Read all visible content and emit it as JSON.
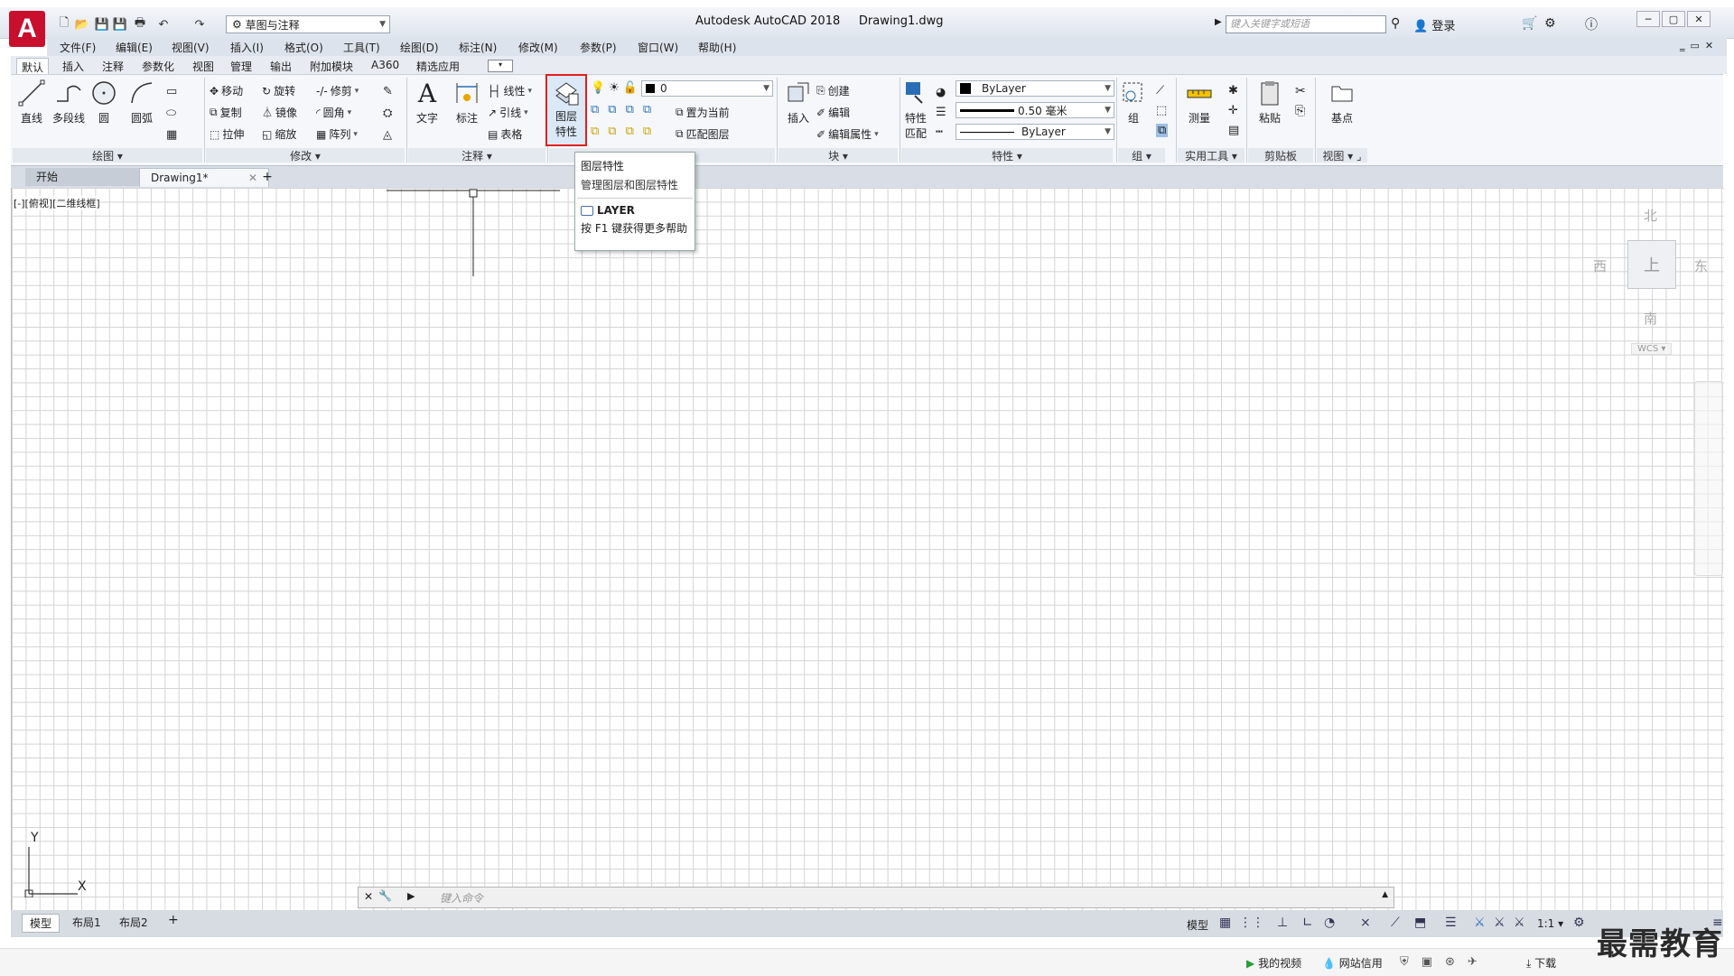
{
  "app": {
    "logo": "A",
    "title": "Autodesk AutoCAD 2018",
    "filename": "Drawing1.dwg",
    "workspace": "草图与注释",
    "search_placeholder": "键入关键字或短语",
    "login": "登录"
  },
  "menu": [
    "文件(F)",
    "编辑(E)",
    "视图(V)",
    "插入(I)",
    "格式(O)",
    "工具(T)",
    "绘图(D)",
    "标注(N)",
    "修改(M)",
    "参数(P)",
    "窗口(W)",
    "帮助(H)"
  ],
  "ribbon_tabs": [
    "默认",
    "插入",
    "注释",
    "参数化",
    "视图",
    "管理",
    "输出",
    "附加模块",
    "A360",
    "精选应用"
  ],
  "draw_panel": {
    "label": "绘图",
    "tools": [
      "直线",
      "多段线",
      "圆",
      "圆弧"
    ]
  },
  "modify_panel": {
    "label": "修改",
    "tools": [
      "移动",
      "旋转",
      "修剪",
      "复制",
      "镜像",
      "圆角",
      "拉伸",
      "缩放",
      "阵列"
    ]
  },
  "annotation_panel": {
    "label": "注释",
    "big": [
      "文字",
      "标注"
    ],
    "small": [
      "线性",
      "引线",
      "表格"
    ]
  },
  "layer_panel": {
    "big_line1": "图层",
    "big_line2": "特性",
    "layer_name": "0",
    "set_current": "置为当前",
    "match_layer": "匹配图层"
  },
  "block_panel": {
    "label": "块",
    "insert": "插入",
    "create": "创建",
    "edit": "编辑",
    "edit_attr": "编辑属性"
  },
  "properties_panel": {
    "label": "特性",
    "match_line1": "特性",
    "match_line2": "匹配",
    "color": "ByLayer",
    "lineweight": "0.50 毫米",
    "linetype": "ByLayer"
  },
  "group_panel": {
    "label": "组",
    "group": "组"
  },
  "utilities_panel": {
    "label": "实用工具",
    "measure": "测量"
  },
  "clipboard_panel": {
    "label": "剪贴板",
    "paste": "粘贴"
  },
  "view_panel": {
    "label": "视图",
    "base": "基点"
  },
  "doc_tabs": [
    "开始",
    "Drawing1*"
  ],
  "viewport_label": "[-][俯视][二维线框]",
  "tooltip": {
    "title": "图层特性",
    "desc": "管理图层和图层特性",
    "command": "LAYER",
    "help": "按 F1 键获得更多帮助"
  },
  "viewcube": {
    "north": "北",
    "south": "南",
    "east": "东",
    "west": "西",
    "face": "上",
    "wcs": "WCS"
  },
  "ucs": {
    "x": "X",
    "y": "Y"
  },
  "command": {
    "placeholder": "键入命令"
  },
  "layout_tabs": [
    "模型",
    "布局1",
    "布局2"
  ],
  "status": {
    "mode": "模型",
    "scale": "1:1"
  },
  "taskbar": {
    "video": "我的视频",
    "credit": "网站信用",
    "download": "下载"
  },
  "watermark": "最需教育",
  "colors": {
    "accent": "#c8102e",
    "highlight": "#e0201c"
  }
}
